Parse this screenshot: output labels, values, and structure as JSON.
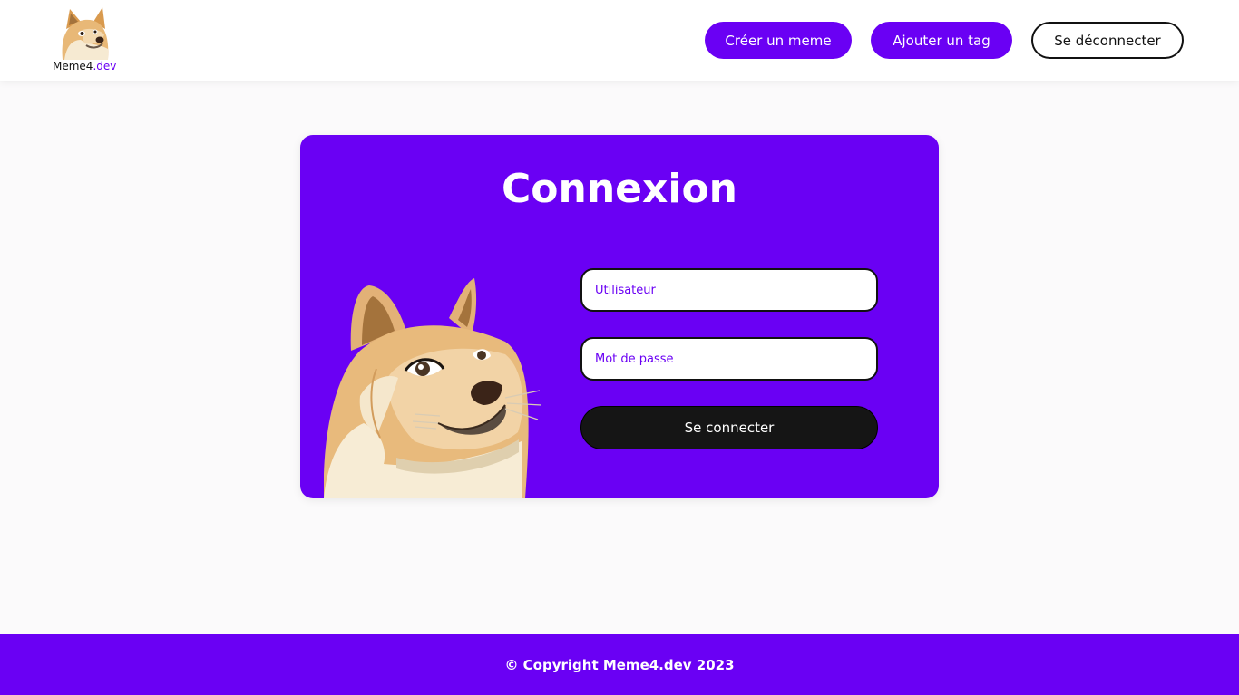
{
  "header": {
    "logo": {
      "name": "Meme4",
      "suffix": ".dev",
      "icon": "doge-icon"
    },
    "nav": {
      "create_label": "Créer un meme",
      "tag_label": "Ajouter un tag",
      "logout_label": "Se déconnecter"
    }
  },
  "login": {
    "title": "Connexion",
    "illustration": "doge-icon",
    "username_placeholder": "Utilisateur",
    "username_value": "",
    "password_placeholder": "Mot de passe",
    "password_value": "",
    "submit_label": "Se connecter"
  },
  "footer": {
    "copyright": "© Copyright Meme4.dev 2023"
  },
  "colors": {
    "accent": "#6a00f4",
    "background": "#fbfafb",
    "dark_button": "#151515",
    "white": "#ffffff"
  }
}
